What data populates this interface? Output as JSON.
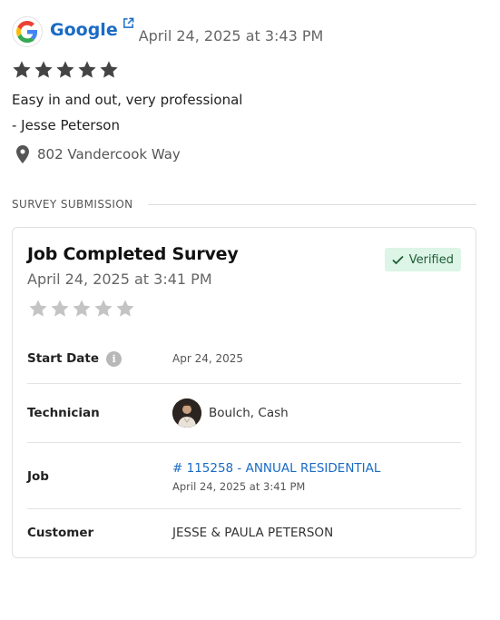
{
  "review": {
    "source_name": "Google",
    "date": "April 24, 2025 at 3:43 PM",
    "rating": 5,
    "text": "Easy in and out, very professional",
    "author": "- Jesse Peterson",
    "location": "802 Vandercook Way"
  },
  "survey_section": {
    "label": "SURVEY SUBMISSION"
  },
  "survey": {
    "title": "Job Completed Survey",
    "date": "April 24, 2025 at 3:41 PM",
    "badge": "Verified",
    "rating": 0,
    "rows": {
      "start_date": {
        "label": "Start Date",
        "value": "Apr 24, 2025"
      },
      "technician": {
        "label": "Technician",
        "value": "Boulch, Cash"
      },
      "job": {
        "label": "Job",
        "value": "# 115258 - ANNUAL RESIDENTIAL",
        "date": "April 24, 2025 at 3:41 PM"
      },
      "customer": {
        "label": "Customer",
        "value": "JESSE & PAULA PETERSON"
      }
    }
  },
  "colors": {
    "link": "#1a6bc4",
    "star_filled": "#444444",
    "star_empty": "#c4c4c4",
    "verified_bg": "#dcf5e6",
    "verified_text": "#1f5c36"
  },
  "icons": [
    "google-logo-icon",
    "external-link-icon",
    "star-icon",
    "location-pin-icon",
    "check-icon",
    "info-icon"
  ]
}
